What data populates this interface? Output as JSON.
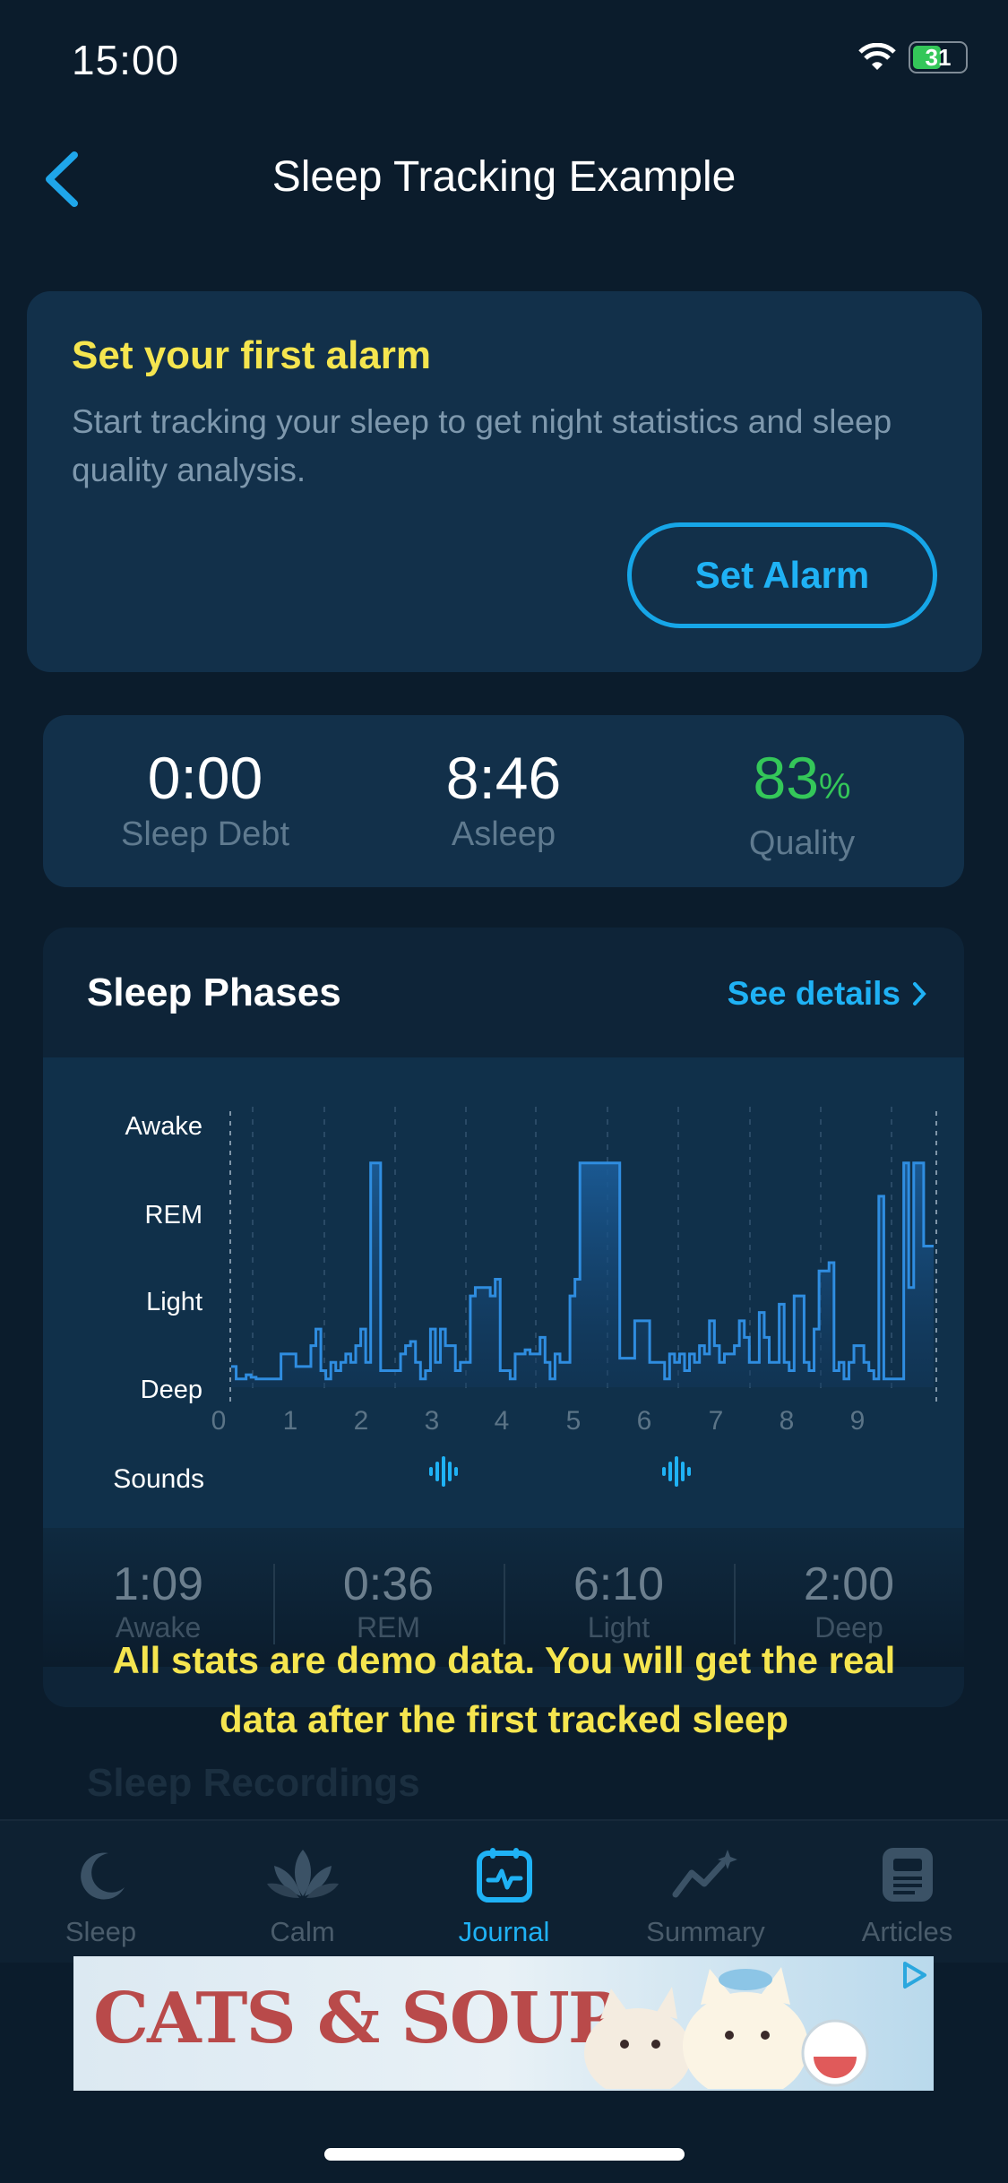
{
  "status": {
    "time": "15:00",
    "battery": "31"
  },
  "nav": {
    "title": "Sleep Tracking Example"
  },
  "alarm_card": {
    "title": "Set your first alarm",
    "description": "Start tracking your sleep to get night statistics and sleep quality analysis.",
    "button": "Set Alarm"
  },
  "stats": {
    "sleep_debt": {
      "value": "0:00",
      "label": "Sleep Debt"
    },
    "asleep": {
      "value": "8:46",
      "label": "Asleep"
    },
    "quality": {
      "value": "83",
      "unit": "%",
      "label": "Quality"
    }
  },
  "phases": {
    "title": "Sleep Phases",
    "see_details": "See details",
    "sounds_label": "Sounds",
    "totals": [
      {
        "value": "1:09",
        "label": "Awake"
      },
      {
        "value": "0:36",
        "label": "REM"
      },
      {
        "value": "6:10",
        "label": "Light"
      },
      {
        "value": "2:00",
        "label": "Deep"
      }
    ]
  },
  "demo_note": "All stats are demo data. You will get the real data after the first tracked sleep",
  "recordings_title": "Sleep Recordings",
  "tabs": [
    {
      "label": "Sleep",
      "icon": "moon-icon"
    },
    {
      "label": "Calm",
      "icon": "lotus-icon"
    },
    {
      "label": "Journal",
      "icon": "calendar-pulse-icon",
      "active": true
    },
    {
      "label": "Summary",
      "icon": "trend-sparkle-icon"
    },
    {
      "label": "Articles",
      "icon": "article-icon"
    }
  ],
  "ad": {
    "text": "CATS & SOUP"
  },
  "colors": {
    "accent": "#1fb2f5",
    "highlight": "#f5e54f",
    "quality": "#34c759"
  },
  "chart_data": {
    "type": "line",
    "ylabels": [
      "Awake",
      "REM",
      "Light",
      "Deep"
    ],
    "xticks": [
      "0",
      "1",
      "2",
      "3",
      "4",
      "5",
      "6",
      "7",
      "8",
      "9"
    ],
    "xlim": [
      0,
      9.8
    ],
    "ylim": [
      0,
      3
    ],
    "step_values": [
      0.25,
      0.1,
      0.1,
      0.15,
      0.12,
      0.1,
      0.1,
      0.1,
      0.1,
      0.1,
      0.4,
      0.4,
      0.4,
      0.25,
      0.25,
      0.25,
      0.5,
      0.7,
      0.2,
      0.1,
      0.3,
      0.2,
      0.3,
      0.4,
      0.3,
      0.5,
      0.7,
      0.3,
      2.7,
      2.7,
      0.2,
      0.2,
      0.2,
      0.2,
      0.4,
      0.5,
      0.55,
      0.3,
      0.1,
      0.2,
      0.7,
      0.3,
      0.7,
      0.5,
      0.5,
      0.2,
      0.3,
      0.3,
      1.1,
      1.2,
      1.2,
      1.2,
      1.1,
      1.3,
      0.2,
      0.2,
      0.1,
      0.4,
      0.4,
      0.45,
      0.4,
      0.4,
      0.6,
      0.3,
      0.1,
      0.4,
      0.3,
      0.3,
      1.1,
      1.3,
      2.7,
      2.7,
      2.7,
      2.7,
      2.7,
      2.7,
      2.7,
      2.7,
      0.35,
      0.35,
      0.35,
      0.8,
      0.8,
      0.8,
      0.3,
      0.3,
      0.3,
      0.1,
      0.4,
      0.3,
      0.4,
      0.2,
      0.4,
      0.3,
      0.5,
      0.4,
      0.8,
      0.5,
      0.3,
      0.4,
      0.4,
      0.5,
      0.8,
      0.6,
      0.3,
      0.3,
      0.9,
      0.6,
      0.3,
      0.3,
      1.0,
      0.3,
      0.2,
      1.1,
      1.1,
      0.3,
      0.2,
      0.7,
      1.4,
      1.4,
      1.5,
      0.2,
      0.3,
      0.1,
      0.3,
      0.5,
      0.5,
      0.3,
      0.2,
      0.1,
      2.3,
      0.1,
      0.1,
      0.1,
      0.1,
      2.7,
      1.2,
      2.7,
      2.7,
      1.7,
      1.7
    ],
    "sound_events_hours": [
      3.0,
      6.25
    ]
  }
}
